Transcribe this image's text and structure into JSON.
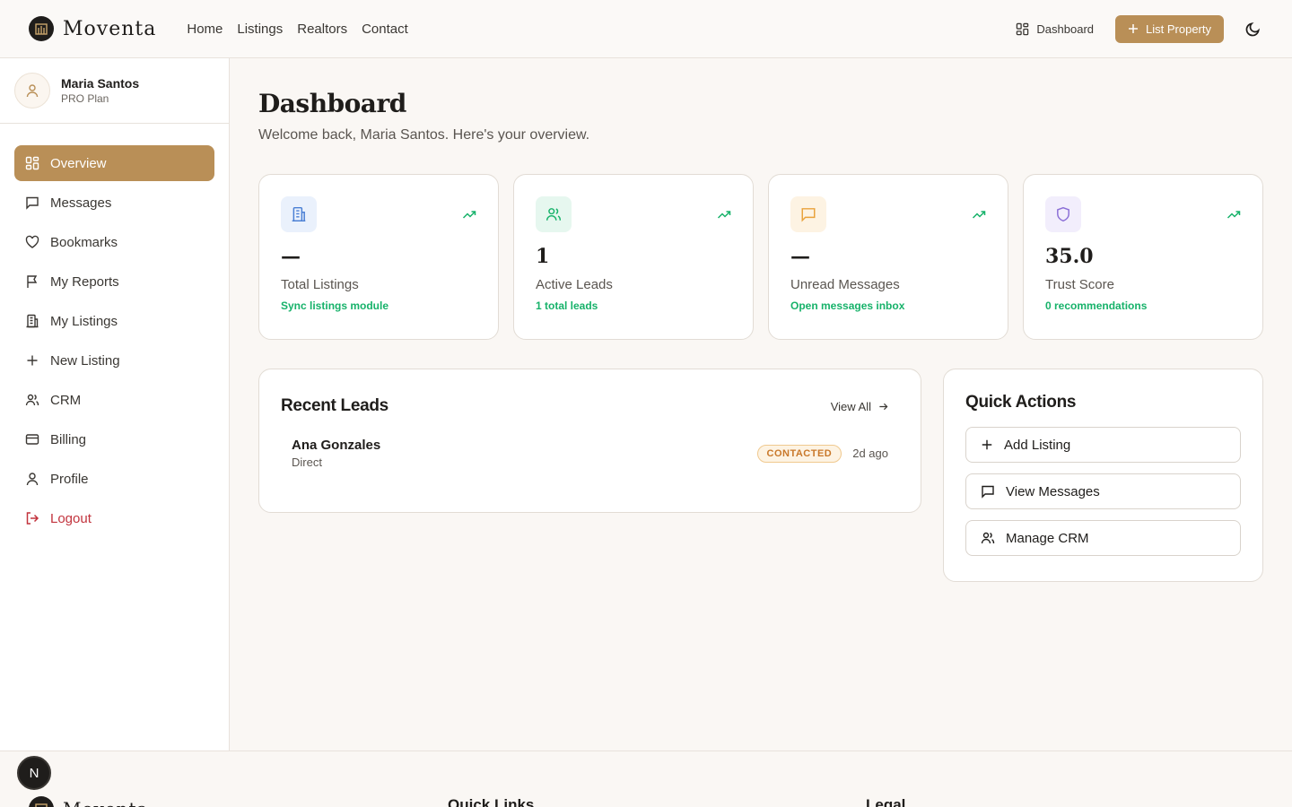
{
  "header": {
    "brand": "Moventa",
    "nav": [
      "Home",
      "Listings",
      "Realtors",
      "Contact"
    ],
    "dashboard_link": "Dashboard",
    "list_property": "List Property"
  },
  "sidebar": {
    "user_name": "Maria Santos",
    "user_plan": "PRO Plan",
    "items": [
      {
        "label": "Overview",
        "icon": "grid-icon"
      },
      {
        "label": "Messages",
        "icon": "message-icon"
      },
      {
        "label": "Bookmarks",
        "icon": "heart-icon"
      },
      {
        "label": "My Reports",
        "icon": "flag-icon"
      },
      {
        "label": "My Listings",
        "icon": "building-icon"
      },
      {
        "label": "New Listing",
        "icon": "plus-icon"
      },
      {
        "label": "CRM",
        "icon": "users-icon"
      },
      {
        "label": "Billing",
        "icon": "card-icon"
      },
      {
        "label": "Profile",
        "icon": "user-icon"
      },
      {
        "label": "Logout",
        "icon": "logout-icon"
      }
    ]
  },
  "main": {
    "title": "Dashboard",
    "subtitle": "Welcome back, Maria Santos. Here's your overview.",
    "stats": [
      {
        "value": "—",
        "label": "Total Listings",
        "link": "Sync listings module",
        "color": "#4a7fd4"
      },
      {
        "value": "1",
        "label": "Active Leads",
        "link": "1 total leads",
        "color": "#17b26a"
      },
      {
        "value": "—",
        "label": "Unread Messages",
        "link": "Open messages inbox",
        "color": "#e9a23b"
      },
      {
        "value": "35.0",
        "label": "Trust Score",
        "link": "0 recommendations",
        "color": "#8b6fd6"
      }
    ],
    "recent_leads": {
      "title": "Recent Leads",
      "view_all": "View All",
      "leads": [
        {
          "name": "Ana Gonzales",
          "source": "Direct",
          "status": "CONTACTED",
          "time": "2d ago"
        }
      ]
    },
    "quick_actions": {
      "title": "Quick Actions",
      "actions": [
        "Add Listing",
        "View Messages",
        "Manage CRM"
      ]
    }
  },
  "footer": {
    "brand": "Moventa",
    "col1": "Quick Links",
    "col2": "Legal",
    "badge": "N"
  },
  "colors": {
    "accent": "#b98f57",
    "positive": "#17b26a",
    "danger": "#c2333d"
  }
}
